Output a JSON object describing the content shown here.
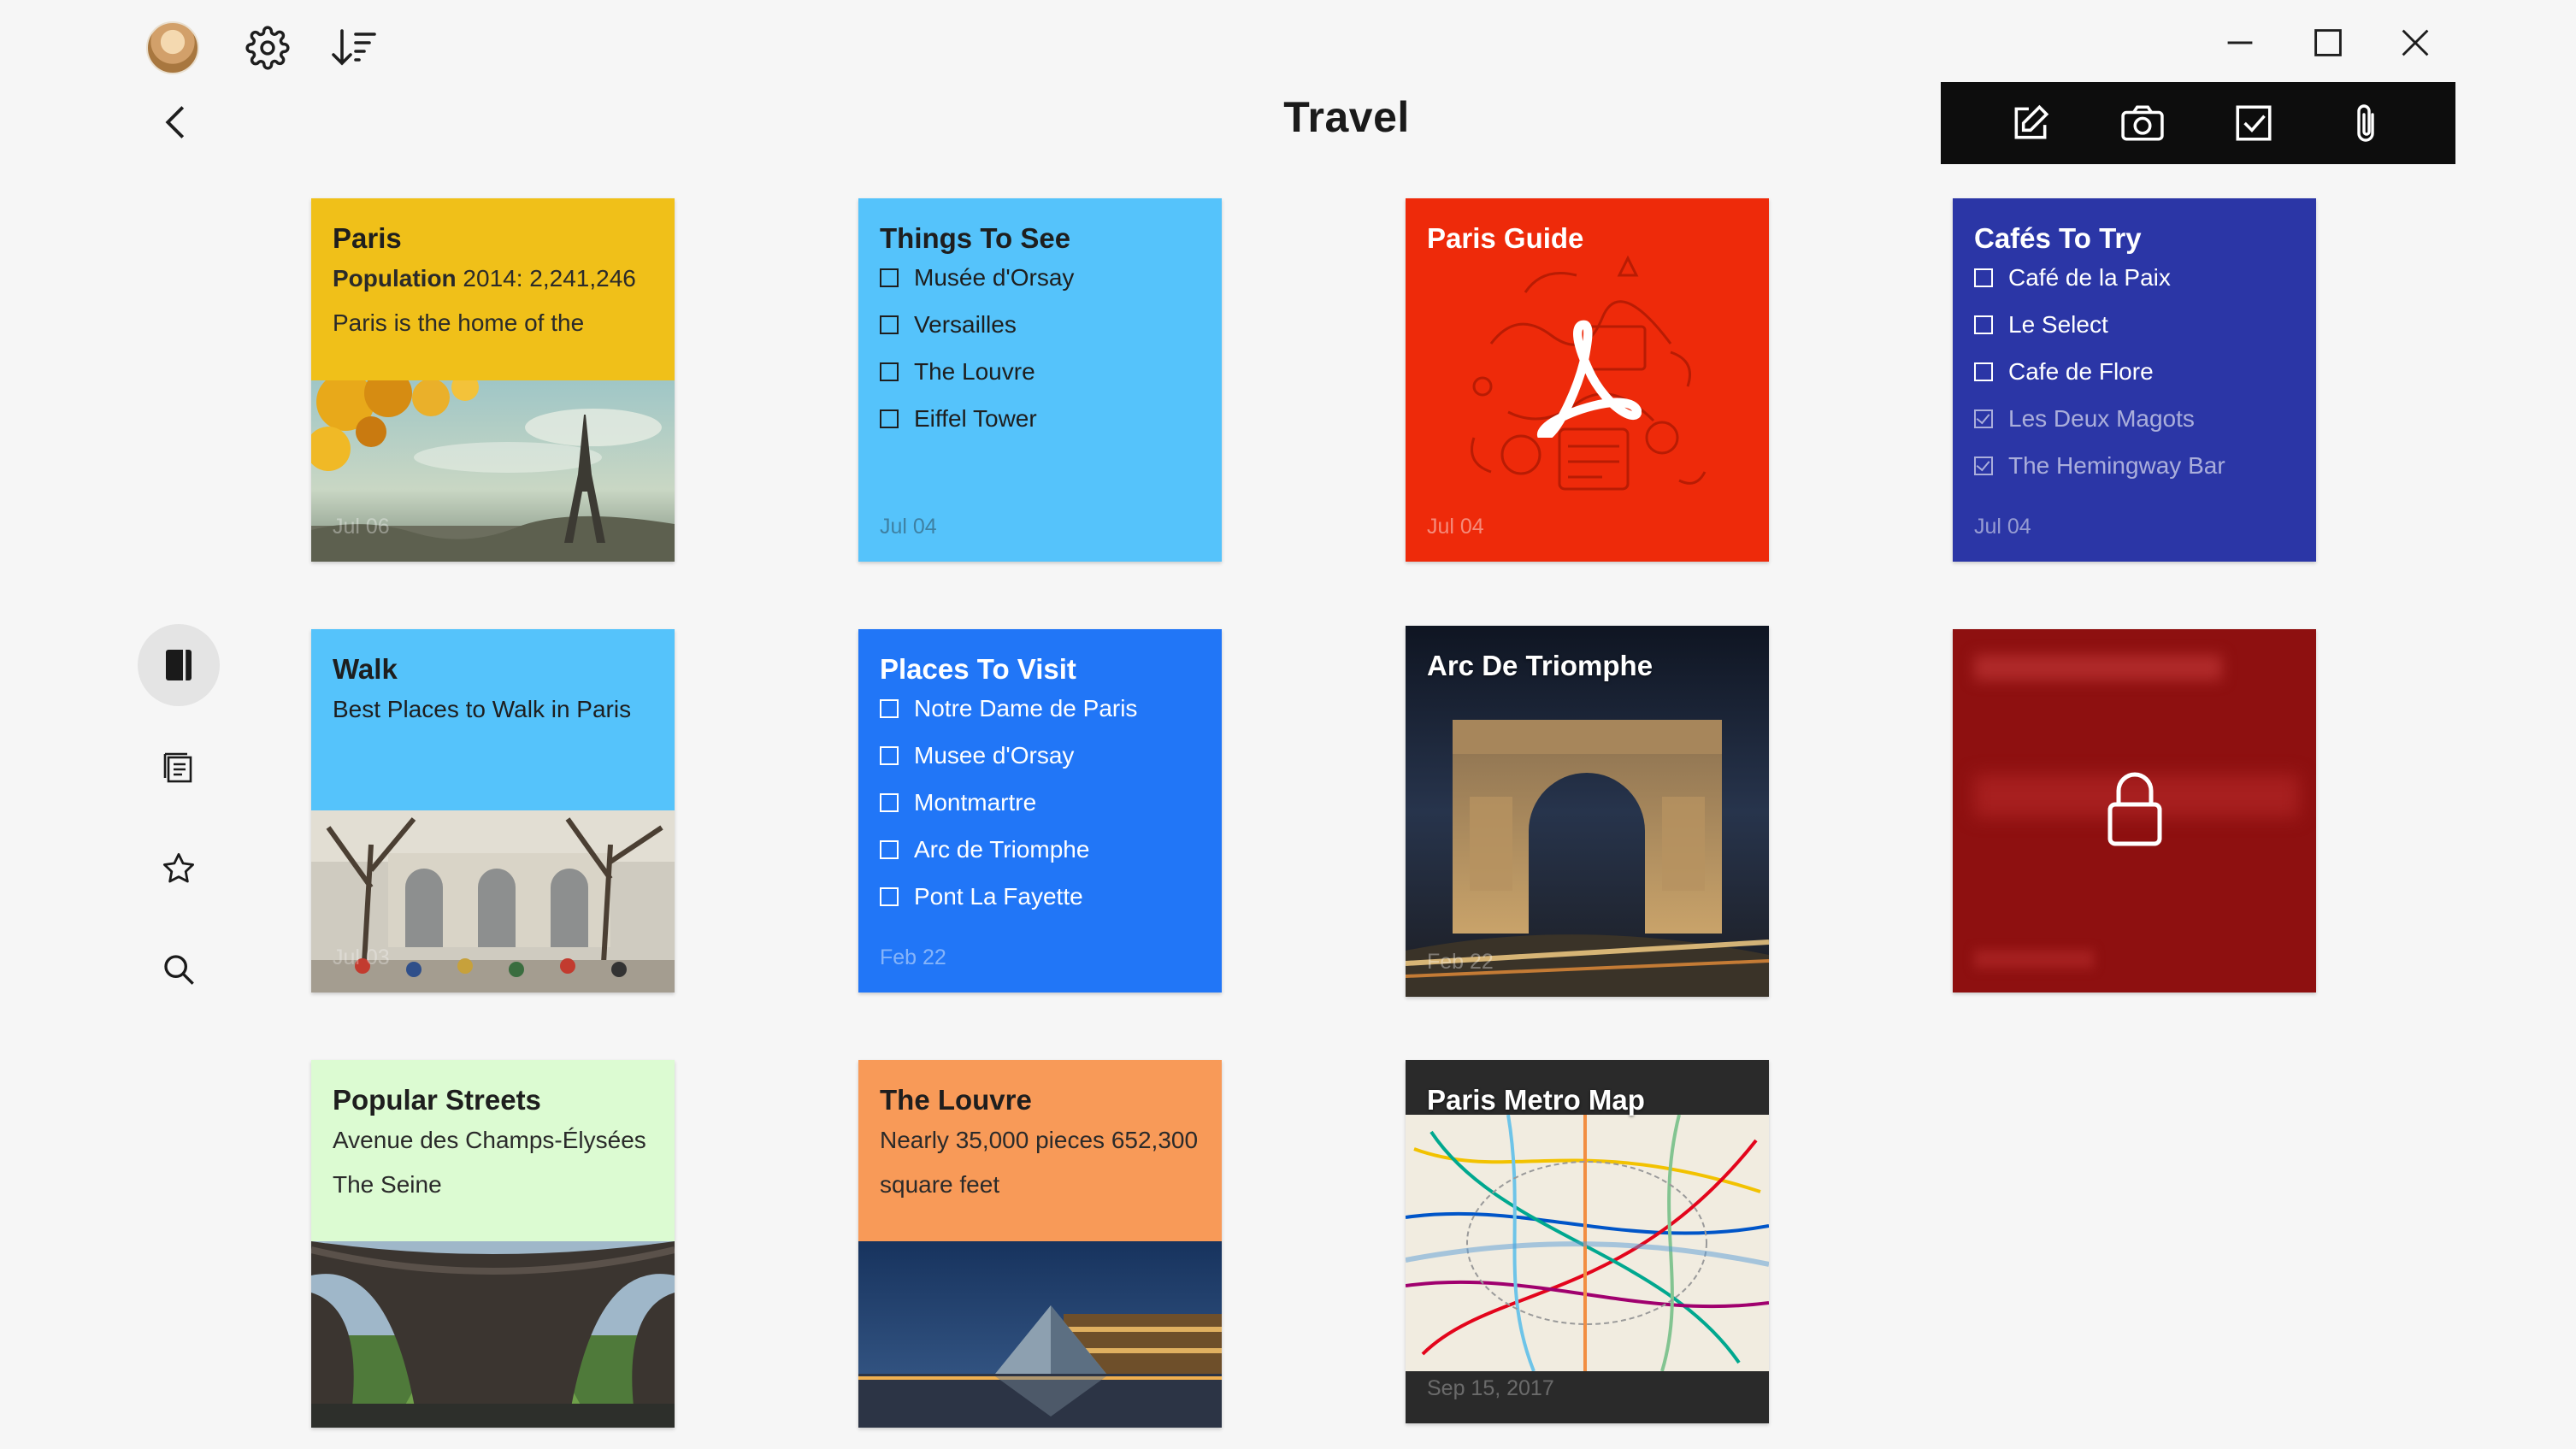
{
  "window": {
    "title": "Travel",
    "controls": {
      "minimize_icon": "minimize-icon",
      "maximize_icon": "maximize-icon",
      "close_icon": "close-icon"
    }
  },
  "topbar": {
    "avatar": "avatar",
    "settings_icon": "gear-icon",
    "sort_icon": "sort-icon",
    "back_icon": "back-arrow-icon"
  },
  "toolbar": {
    "background": "#0d0d0d",
    "items": [
      "new-note-icon",
      "camera-icon",
      "checklist-icon",
      "attachment-icon"
    ]
  },
  "sidebar": {
    "items": [
      {
        "icon": "notebook-icon",
        "active": true
      },
      {
        "icon": "notes-icon",
        "active": false
      },
      {
        "icon": "star-icon",
        "active": false
      },
      {
        "icon": "search-icon",
        "active": false
      }
    ]
  },
  "cards": [
    {
      "id": "paris",
      "title": "Paris",
      "color": "#f0c019",
      "lines": [
        {
          "bold": "Population",
          "text": " 2014: 2,241,246"
        },
        {
          "text": "Paris is the home of the"
        }
      ],
      "date": "Jul 06"
    },
    {
      "id": "things-to-see",
      "title": "Things To See",
      "color": "#55c3fb",
      "checklist": [
        {
          "label": "Musée d'Orsay",
          "done": false
        },
        {
          "label": "Versailles",
          "done": false
        },
        {
          "label": "The Louvre",
          "done": false
        },
        {
          "label": "Eiffel Tower",
          "done": false
        }
      ],
      "date": "Jul 04"
    },
    {
      "id": "paris-guide",
      "title": "Paris Guide",
      "color": "#ee2a0a",
      "attachment": "pdf-icon",
      "date": "Jul 04"
    },
    {
      "id": "cafes-to-try",
      "title": "Cafés To Try",
      "color": "#2b36a6",
      "checklist": [
        {
          "label": "Café de la Paix",
          "done": false
        },
        {
          "label": "Le Select",
          "done": false
        },
        {
          "label": "Cafe de Flore",
          "done": false
        },
        {
          "label": "Les Deux Magots",
          "done": true
        },
        {
          "label": "The Hemingway Bar",
          "done": true
        }
      ],
      "date": "Jul 04"
    },
    {
      "id": "walk",
      "title": "Walk",
      "color": "#55c3fb",
      "lines": [
        {
          "text": "Best Places to Walk in Paris"
        }
      ],
      "date": "Jul 03"
    },
    {
      "id": "places-to-visit",
      "title": "Places To Visit",
      "color": "#2176f7",
      "checklist": [
        {
          "label": "Notre Dame de Paris",
          "done": false
        },
        {
          "label": "Musee d'Orsay",
          "done": false
        },
        {
          "label": "Montmartre",
          "done": false
        },
        {
          "label": "Arc de Triomphe",
          "done": false
        },
        {
          "label": "Pont La Fayette",
          "done": false
        }
      ],
      "date": "Feb 22"
    },
    {
      "id": "arc-de-triomphe",
      "title": "Arc De Triomphe",
      "date": "Feb 22"
    },
    {
      "id": "locked-note",
      "color": "#8e1010",
      "locked": true,
      "lock_icon": "lock-icon"
    },
    {
      "id": "popular-streets",
      "title": "Popular Streets",
      "color": "#dcfbd2",
      "lines": [
        {
          "text": "Avenue des Champs-Élysées"
        },
        {
          "text": "The Seine"
        }
      ]
    },
    {
      "id": "the-louvre",
      "title": "The Louvre",
      "color": "#f89a58",
      "lines": [
        {
          "text": "Nearly 35,000 pieces 652,300"
        },
        {
          "text": "square feet"
        }
      ]
    },
    {
      "id": "paris-metro-map",
      "title": "Paris Metro Map",
      "date": "Sep 15, 2017"
    }
  ]
}
